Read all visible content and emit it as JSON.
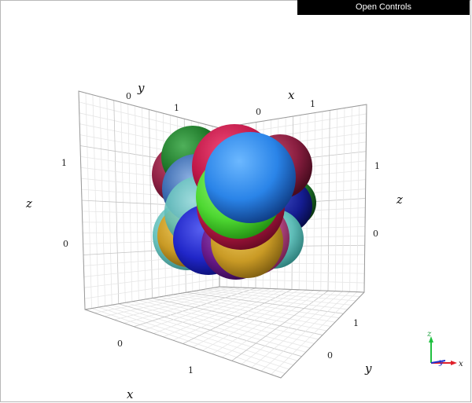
{
  "controls": {
    "label": "Open Controls"
  },
  "axes": {
    "x_letter": "x",
    "y_letter": "y",
    "z_letter": "z",
    "ticks": {
      "zero": "0",
      "one": "1"
    }
  },
  "triad": {
    "x": "x",
    "y": "y",
    "z": "z",
    "colors": {
      "x": "#e0202a",
      "y": "#2030d0",
      "z": "#20c040"
    }
  },
  "colors": {
    "spheres": [
      "#8a1e40",
      "#1f7a2a",
      "#c99a25",
      "#5fbdb8",
      "#2026c8",
      "#c01848",
      "#2a8e3a",
      "#6a1a8a",
      "#3a6ab0",
      "#4ed832",
      "#d8a030",
      "#2a84e8"
    ]
  }
}
